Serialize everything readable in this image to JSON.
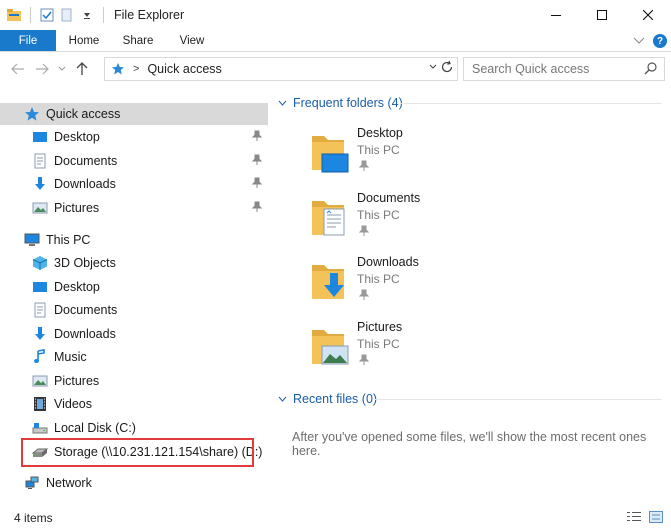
{
  "window": {
    "title": "File Explorer",
    "minimize": "—",
    "maximize": "☐",
    "close": "✕"
  },
  "ribbon": {
    "file_tab": "File",
    "tabs": [
      "Home",
      "Share",
      "View"
    ]
  },
  "address": {
    "path": "Quick access",
    "search_placeholder": "Search Quick access"
  },
  "nav": {
    "quick_access": "Quick access",
    "quick_items": [
      "Desktop",
      "Documents",
      "Downloads",
      "Pictures"
    ],
    "this_pc": "This PC",
    "pc_items": [
      "3D Objects",
      "Desktop",
      "Documents",
      "Downloads",
      "Music",
      "Pictures",
      "Videos",
      "Local Disk (C:)",
      "Storage (\\\\10.231.121.154\\share) (D:)"
    ],
    "network": "Network"
  },
  "content": {
    "frequent_header": "Frequent folders (4)",
    "folders": [
      {
        "name": "Desktop",
        "location": "This PC"
      },
      {
        "name": "Documents",
        "location": "This PC"
      },
      {
        "name": "Downloads",
        "location": "This PC"
      },
      {
        "name": "Pictures",
        "location": "This PC"
      }
    ],
    "recent_header": "Recent files (0)",
    "empty_message": "After you've opened some files, we'll show the most recent ones here."
  },
  "status": {
    "item_count": "4 items"
  },
  "colors": {
    "accent": "#1979ca",
    "selection": "#d9d9d9",
    "highlight_border": "#e23b3b",
    "group_header": "#1a5ea8",
    "folder_yellow": "#f3c35a"
  }
}
